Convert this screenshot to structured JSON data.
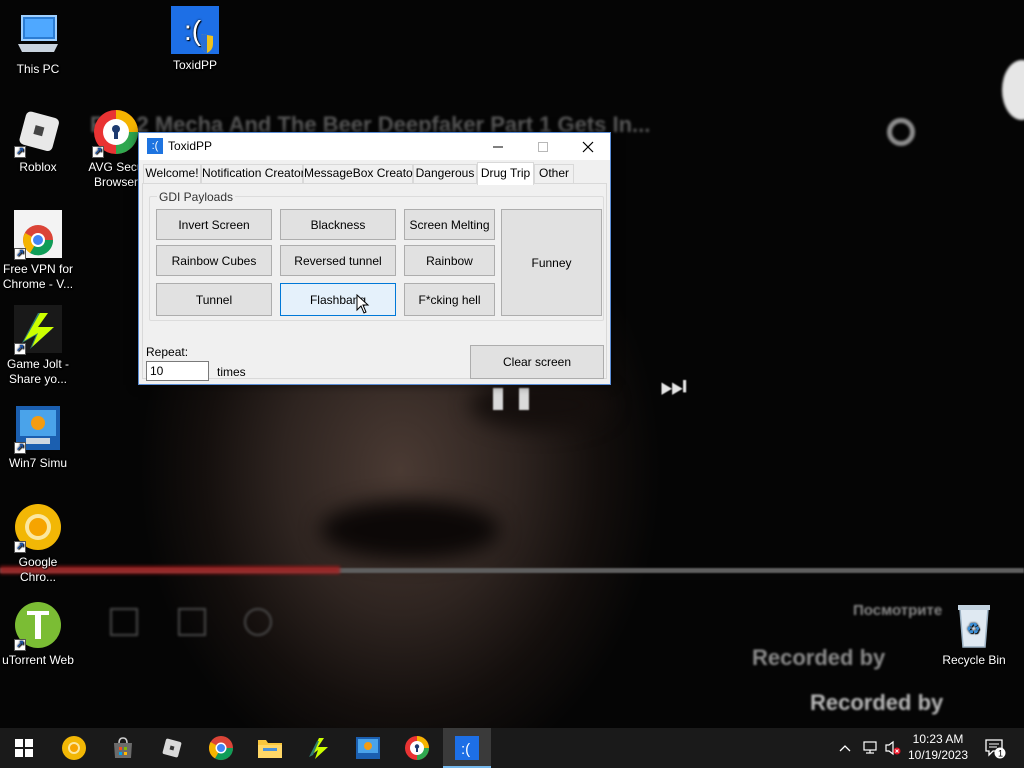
{
  "wallpaper": {
    "video_title": "Pr... 2 Mecha And The Beer Deepfaker Part 1 Gets In...",
    "recorded_1": "Recorded by ",
    "recorded_2": "Recorded by ",
    "small_caption": "Посмотрите"
  },
  "desktop": {
    "icons": [
      {
        "label": "This PC",
        "icon": "computer-icon"
      },
      {
        "label": "ToxidPP",
        "icon": "toxidpp-icon"
      },
      {
        "label": "Roblox",
        "icon": "roblox-icon"
      },
      {
        "label": "AVG Secu Browser",
        "icon": "avg-browser-icon"
      },
      {
        "label": "Free VPN for Chrome - V...",
        "icon": "chrome-vpn-icon"
      },
      {
        "label": "Game Jolt - Share yo...",
        "icon": "gamejolt-icon"
      },
      {
        "label": "Win7 Simu",
        "icon": "win7-simu-icon"
      },
      {
        "label": "Google Chro...",
        "icon": "chrome-canary-icon"
      },
      {
        "label": "uTorrent Web",
        "icon": "utorrent-icon"
      },
      {
        "label": "Recycle Bin",
        "icon": "recycle-bin-icon"
      }
    ]
  },
  "window": {
    "title": "ToxidPP",
    "tabs": [
      "Welcome!",
      "Notification Creator",
      "MessageBox Creator",
      "Dangerous",
      "Drug Trip",
      "Other"
    ],
    "active_tab": "Drug Trip",
    "group_label": "GDI Payloads",
    "buttons": {
      "invert_screen": "Invert Screen",
      "blackness": "Blackness",
      "screen_melting": "Screen Melting",
      "funney": "Funney",
      "rainbow_cubes": "Rainbow Cubes",
      "reversed_tunnel": "Reversed tunnel",
      "rainbow": "Rainbow",
      "tunnel": "Tunnel",
      "flashbang": "Flashbang",
      "fcking_hell": "F*cking hell"
    },
    "repeat_label": "Repeat:",
    "repeat_value": "10",
    "times_label": "times",
    "clear_screen": "Clear screen"
  },
  "taskbar": {
    "items": [
      "start",
      "chrome-canary",
      "store",
      "roblox",
      "chrome",
      "file-explorer",
      "gamejolt",
      "win7-simu",
      "avg-browser",
      "toxidpp"
    ],
    "active_item": "toxidpp",
    "time": "10:23 AM",
    "date": "10/19/2023",
    "notification_count": "1"
  }
}
